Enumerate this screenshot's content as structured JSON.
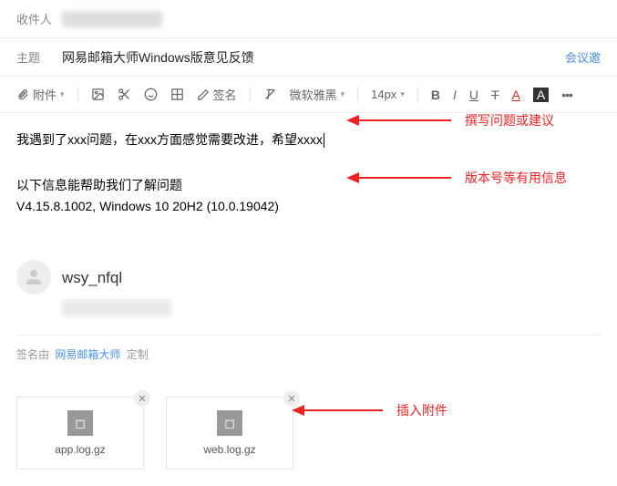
{
  "header": {
    "recipient_label": "收件人",
    "subject_label": "主题",
    "subject_value": "网易邮箱大师Windows版意见反馈",
    "meeting_link": "会议邀"
  },
  "toolbar": {
    "attachment": "附件",
    "signature": "签名",
    "font_family": "微软雅黑",
    "font_size": "14px",
    "bold": "B",
    "italic": "I",
    "underline": "U",
    "strike": "T",
    "color": "A",
    "bgcolor": "A",
    "more": "•••"
  },
  "body": {
    "line1": "我遇到了xxx问题，在xxx方面感觉需要改进，希望xxxx",
    "info_header": "以下信息能帮助我们了解问题",
    "version": "V4.15.8.1002, Windows 10 20H2 (10.0.19042)"
  },
  "signature": {
    "name": "wsy_nfql",
    "footer_prefix": "签名由",
    "footer_link": "网易邮箱大师",
    "footer_suffix": "定制"
  },
  "attachments": [
    {
      "name": "app.log.gz"
    },
    {
      "name": "web.log.gz"
    }
  ],
  "annotations": {
    "a1": "撰写问题或建议",
    "a2": "版本号等有用信息",
    "a3": "插入附件"
  }
}
